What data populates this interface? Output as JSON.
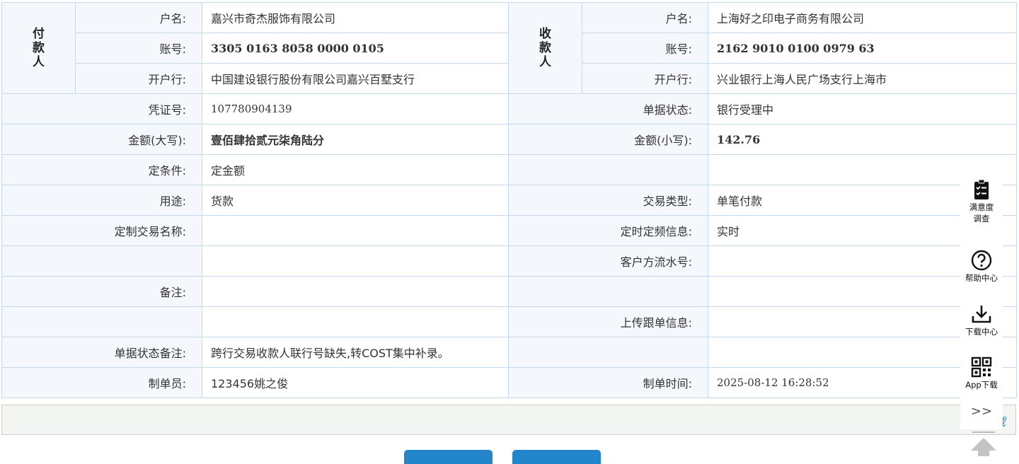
{
  "payer": {
    "header_chars": [
      "付",
      "款",
      "人"
    ],
    "name_label": "户名:",
    "name": "嘉兴市奇杰服饰有限公司",
    "account_label": "账号:",
    "account": "3305 0163 8058 0000 0105",
    "bank_label": "开户行:",
    "bank": "中国建设银行股份有限公司嘉兴百墅支行"
  },
  "payee": {
    "header_chars": [
      "收",
      "款",
      "人"
    ],
    "name_label": "户名:",
    "name": "上海好之印电子商务有限公司",
    "account_label": "账号:",
    "account": "2162 9010 0100 0979 63",
    "bank_label": "开户行:",
    "bank": "兴业银行上海人民广场支行上海市"
  },
  "details": {
    "voucher_label": "凭证号:",
    "voucher": "107780904139",
    "status_label": "单据状态:",
    "status": "银行受理中",
    "amount_upper_label": "金额(大写):",
    "amount_upper": "壹佰肆拾贰元柒角陆分",
    "amount_lower_label": "金额(小写):",
    "amount_lower": "142.76",
    "condition_label": "定条件:",
    "condition": "定金额",
    "purpose_label": "用途:",
    "purpose": "货款",
    "trade_type_label": "交易类型:",
    "trade_type": "单笔付款",
    "custom_name_label": "定制交易名称:",
    "custom_name": "",
    "schedule_label": "定时定频信息:",
    "schedule": "实时",
    "client_serial_label": "客户方流水号:",
    "client_serial": "",
    "remark_label": "备注:",
    "remark": "",
    "upload_label": "上传跟单信息:",
    "upload": "",
    "status_remark_label": "单据状态备注:",
    "status_remark": "跨行交易收款人联行号缺失,转COST集中补录。",
    "maker_label": "制单员:",
    "maker": "123456姚之俊",
    "make_time_label": "制单时间:",
    "make_time": "2025-08-12 16:28:52"
  },
  "footer": {
    "link_text": "载"
  },
  "sidebar": {
    "survey_line1": "满意度",
    "survey_line2": "调查",
    "help": "帮助中心",
    "download": "下载中心",
    "app": "App下载",
    "collapse": ">>",
    "survey_icon": "clipboard-check-icon",
    "help_icon": "question-circle-icon",
    "download_icon": "download-icon",
    "app_icon": "qr-code-icon"
  },
  "colors": {
    "label_bg": "#f4f8fc",
    "border": "#c6d9ec",
    "button": "#2386cc",
    "link": "#1d84c9"
  }
}
